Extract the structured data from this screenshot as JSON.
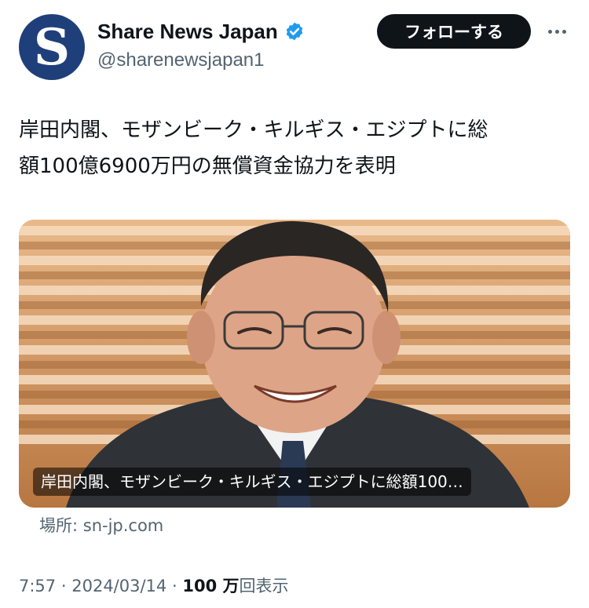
{
  "account": {
    "avatar_letter": "S",
    "display_name": "Share News Japan",
    "handle": "@sharenewsjapan1"
  },
  "actions": {
    "follow_label": "フォローする",
    "more_icon": "more-horizontal-icon"
  },
  "tweet": {
    "text": "岸田内閣、モザンビーク・キルギス・エジプトに総\n額100億6900万円の無償資金協力を表明"
  },
  "card": {
    "title": "岸田内閣、モザンビーク・キルギス・エジプトに総額100…",
    "source": "場所: sn-jp.com"
  },
  "meta": {
    "time": "7:57",
    "separator": "·",
    "date": "2024/03/14",
    "views_count": "100 万",
    "views_label": "回表示"
  },
  "colors": {
    "brand_blue": "#1d9bf0",
    "avatar_navy": "#1f3f7a",
    "text_primary": "#0f1419",
    "text_secondary": "#536471"
  }
}
